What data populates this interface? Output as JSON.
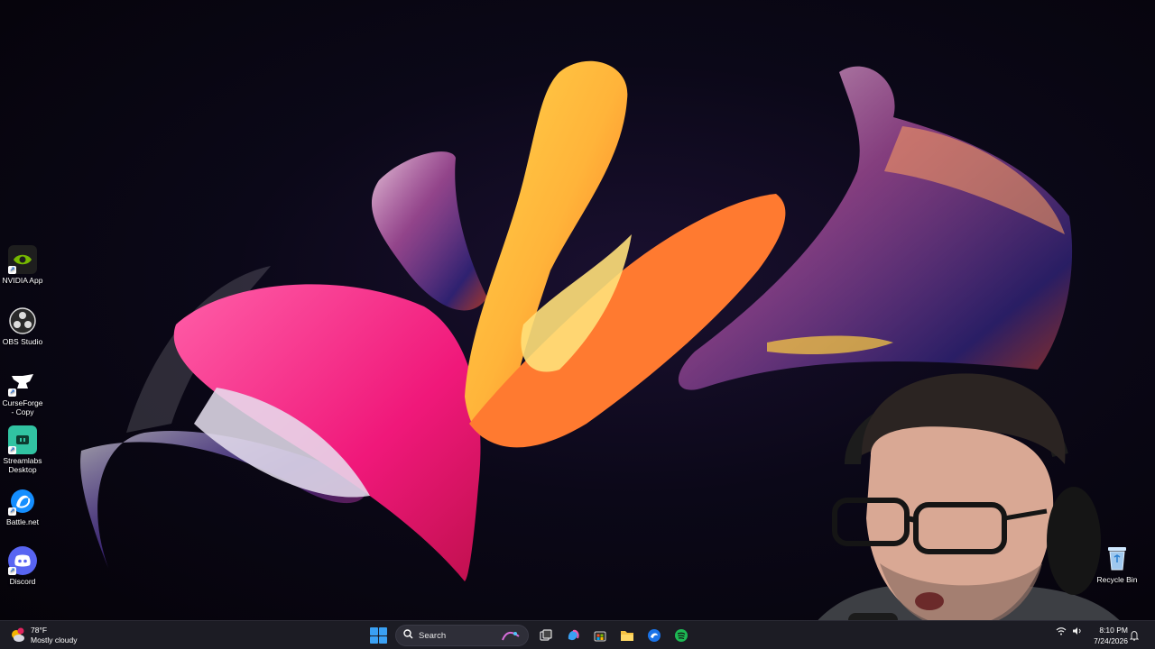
{
  "desktop": {
    "icons": [
      {
        "label": "NVIDIA App",
        "icon": "nvidia-icon",
        "color": "#76b900"
      },
      {
        "label": "OBS Studio",
        "icon": "obs-icon",
        "color": "#2a2a2a"
      },
      {
        "label": "CurseForge - Copy",
        "icon": "curseforge-icon",
        "color": "#111111"
      },
      {
        "label": "Streamlabs Desktop",
        "icon": "streamlabs-icon",
        "color": "#31c3a2"
      },
      {
        "label": "Battle.net",
        "icon": "battlenet-icon",
        "color": "#148eff"
      },
      {
        "label": "Discord",
        "icon": "discord-icon",
        "color": "#5865f2"
      }
    ],
    "recycle_bin": {
      "label": "Recycle Bin",
      "icon": "recycle-bin-icon"
    }
  },
  "taskbar": {
    "weather": {
      "temp": "78°F",
      "condition": "Mostly cloudy",
      "badge": "1"
    },
    "search": {
      "placeholder": "Search"
    },
    "apps": [
      "task-view-icon",
      "copilot-icon",
      "store-icon",
      "file-explorer-icon",
      "edge-icon",
      "spotify-icon"
    ],
    "clock": {
      "time": "8:10 PM",
      "date": "7/24/2026"
    }
  },
  "colors": {
    "taskbar_bg": "#1c1c24",
    "accent": "#3aa0f3"
  }
}
